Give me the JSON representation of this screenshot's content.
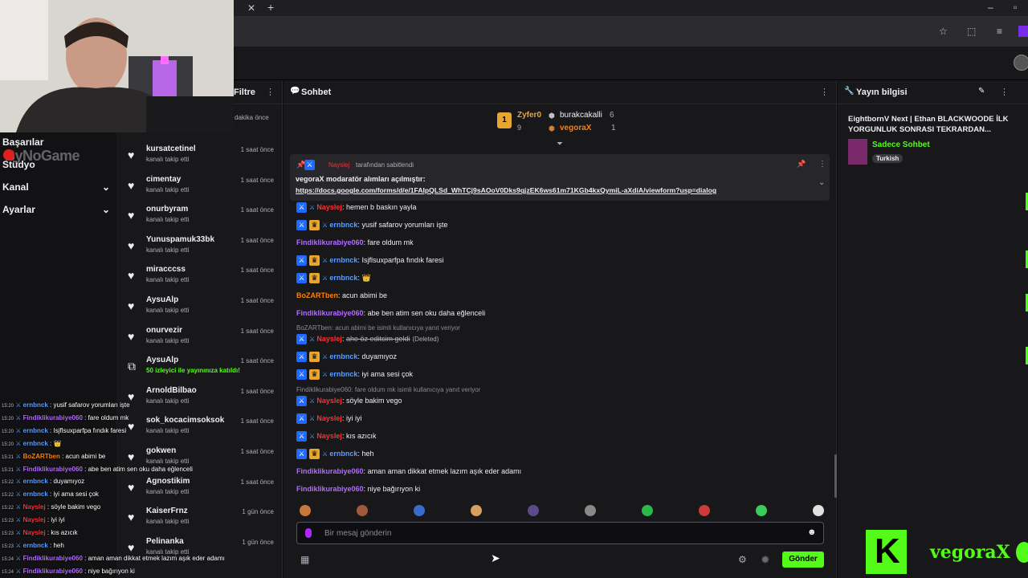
{
  "browser": {
    "icons": [
      "close-tab-icon",
      "new-tab-icon",
      "minimize-icon",
      "maximize-icon",
      "bookmark-star-icon",
      "extensions-icon",
      "media-icon",
      "profile-icon"
    ]
  },
  "left_nav": {
    "items": [
      {
        "label": "Başarılar",
        "chevron": false
      },
      {
        "label": "Stüdyo",
        "chevron": false
      },
      {
        "label": "Kanal",
        "chevron": true
      },
      {
        "label": "Ayarlar",
        "chevron": true
      }
    ],
    "watermark": "ByNoGame"
  },
  "activity": {
    "filter_label": "Filtre",
    "first_time": "dakika önce",
    "items": [
      {
        "name": "kursatcetinel",
        "sub": "kanalı takip etti",
        "time": "1 saat önce",
        "icon": "heart-icon"
      },
      {
        "name": "cimentay",
        "sub": "kanalı takip etti",
        "time": "1 saat önce",
        "icon": "heart-icon"
      },
      {
        "name": "onurbyram",
        "sub": "kanalı takip etti",
        "time": "1 saat önce",
        "icon": "heart-icon"
      },
      {
        "name": "Yunuspamuk33bk",
        "sub": "kanalı takip etti",
        "time": "1 saat önce",
        "icon": "heart-icon"
      },
      {
        "name": "miracccss",
        "sub": "kanalı takip etti",
        "time": "1 saat önce",
        "icon": "heart-icon"
      },
      {
        "name": "AysuAlp",
        "sub": "kanalı takip etti",
        "time": "1 saat önce",
        "icon": "heart-icon"
      },
      {
        "name": "onurvezir",
        "sub": "kanalı takip etti",
        "time": "1 saat önce",
        "icon": "heart-icon"
      },
      {
        "name": "AysuAlp",
        "sub": "50 izleyici ile yayınınıza katıldı!",
        "time": "1 saat önce",
        "icon": "raid-icon"
      },
      {
        "name": "ArnoldBilbao",
        "sub": "kanalı takip etti",
        "time": "1 saat önce",
        "icon": "heart-icon"
      },
      {
        "name": "sok_kocacimsoksok",
        "sub": "kanalı takip etti",
        "time": "1 saat önce",
        "icon": "heart-icon"
      },
      {
        "name": "gokwen",
        "sub": "kanalı takip etti",
        "time": "1 saat önce",
        "icon": "heart-icon"
      },
      {
        "name": "Agnostikim",
        "sub": "kanalı takip etti",
        "time": "1 saat önce",
        "icon": "heart-icon"
      },
      {
        "name": "KaiserFrnz",
        "sub": "kanalı takip etti",
        "time": "1 gün önce",
        "icon": "heart-icon"
      },
      {
        "name": "Pelinanka",
        "sub": "kanalı takip etti",
        "time": "1 gün önce",
        "icon": "heart-icon"
      }
    ]
  },
  "chat": {
    "title": "Sohbet",
    "leaderboard": [
      {
        "name": "Zyfer0",
        "count": "9",
        "rank": "1"
      },
      {
        "name": "burakcakalli",
        "count": "6"
      },
      {
        "name": "vegoraX",
        "count": "1"
      }
    ],
    "pinned": {
      "by": "Nayslej",
      "by_suffix": "tarafından sabitlendi",
      "text": "vegoraX modaratör alımları açılmıştır:",
      "link": "https://docs.google.com/forms/d/e/1FAIpQLSd_WhTCj9sAOoV0Dks9qjzEK6ws61m71KGb4kxQymiL-aXdiA/viewform?usp=dialog"
    },
    "messages": [
      {
        "user": "Nayslej",
        "cls": "u-nay",
        "badges": [
          "mod"
        ],
        "text": "hemen b baskın yayla"
      },
      {
        "user": "ernbnck",
        "cls": "u-ern",
        "badges": [
          "mod",
          "vip"
        ],
        "text": "yusif safarov yorumları işte"
      },
      {
        "user": "Findiklikurabiye060",
        "cls": "u-fin",
        "badges": [],
        "text": "fare oldum mk"
      },
      {
        "user": "ernbnck",
        "cls": "u-ern",
        "badges": [
          "mod",
          "vip"
        ],
        "text": "Isjflsuxparfpa fındık faresi"
      },
      {
        "user": "ernbnck",
        "cls": "u-ern",
        "badges": [
          "mod",
          "vip"
        ],
        "text": "👑"
      },
      {
        "user": "BoZARTben",
        "cls": "u-boz",
        "badges": [],
        "text": "acun abimi be"
      },
      {
        "user": "Findiklikurabiye060",
        "cls": "u-fin",
        "badges": [],
        "text": "abe ben atim sen oku daha eğlenceli"
      },
      {
        "reply": "BoZARTben: acun abimi be isimli kullanıcıya yanıt veriyor",
        "user": "Nayslej",
        "cls": "u-nay",
        "badges": [
          "mod"
        ],
        "text": "ahe öz editcim geldi",
        "deleted": "(Deleted)"
      },
      {
        "user": "ernbnck",
        "cls": "u-ern",
        "badges": [
          "mod",
          "vip"
        ],
        "text": "duyamıyoz"
      },
      {
        "user": "ernbnck",
        "cls": "u-ern",
        "badges": [
          "mod",
          "vip"
        ],
        "text": "iyi ama sesi çok"
      },
      {
        "reply": "Findiklikurabiye060: fare oldum mk isimli kullanıcıya yanıt veriyor",
        "user": "Nayslej",
        "cls": "u-nay",
        "badges": [
          "mod"
        ],
        "text": "söyle bakim vego"
      },
      {
        "user": "Nayslej",
        "cls": "u-nay",
        "badges": [
          "mod"
        ],
        "text": "iyi iyi"
      },
      {
        "user": "Nayslej",
        "cls": "u-nay",
        "badges": [
          "mod"
        ],
        "text": "kıs azıcık"
      },
      {
        "user": "ernbnck",
        "cls": "u-ern",
        "badges": [
          "mod",
          "vip"
        ],
        "text": "heh"
      },
      {
        "user": "Findiklikurabiye060",
        "cls": "u-fin",
        "badges": [],
        "text": "aman aman dikkat etmek lazım aşık eder adamı"
      },
      {
        "user": "Findiklikurabiye060",
        "cls": "u-fin",
        "badges": [],
        "text": "niye bağırıyon ki"
      }
    ],
    "input_placeholder": "Bir mesaj gönderin",
    "send_label": "Gönder",
    "emote_colors": [
      "#c8783c",
      "#a05a3a",
      "#3a6acc",
      "#d4a060",
      "#5a4a8a",
      "#888888",
      "#2ab84a",
      "#cc3a3a",
      "#3acc5a",
      "#e0e0e0"
    ]
  },
  "info": {
    "title": "Yayın bilgisi",
    "stream_title": "EightbornV Next | Ethan BLACKWOODE İLK YORGUNLUK SONRASI TEKRARDAN...",
    "category": "Sadece Sohbet",
    "tag": "Turkish",
    "brand": "vegoraX",
    "accent": "#53fc18"
  },
  "overlay": [
    {
      "time": "15:20",
      "user": "ernbnck",
      "cls": "u-ern",
      "text": "yusif safarov yorumları işte"
    },
    {
      "time": "15:20",
      "user": "Findiklikurabiye060",
      "cls": "u-fin",
      "text": "fare oldum mk"
    },
    {
      "time": "15:20",
      "user": "ernbnck",
      "cls": "u-ern",
      "text": "Isjflsuxparfpa fındık faresi"
    },
    {
      "time": "15:20",
      "user": "ernbnck",
      "cls": "u-ern",
      "text": "👑"
    },
    {
      "time": "15:21",
      "user": "BoZARTben",
      "cls": "u-boz",
      "text": "acun abimi be"
    },
    {
      "time": "15:21",
      "user": "Findiklikurabiye060",
      "cls": "u-fin",
      "text": "abe ben atim sen oku daha eğlenceli"
    },
    {
      "time": "15:22",
      "user": "ernbnck",
      "cls": "u-ern",
      "text": "duyamıyoz"
    },
    {
      "time": "15:22",
      "user": "ernbnck",
      "cls": "u-ern",
      "text": "iyi ama sesi çok"
    },
    {
      "time": "15:22",
      "user": "Nayslej",
      "cls": "u-nay",
      "text": "söyle bakim vego"
    },
    {
      "time": "15:23",
      "user": "Nayslej",
      "cls": "u-nay",
      "text": "iyi iyi"
    },
    {
      "time": "15:23",
      "user": "Nayslej",
      "cls": "u-nay",
      "text": "kıs azıcık"
    },
    {
      "time": "15:23",
      "user": "ernbnck",
      "cls": "u-ern",
      "text": "heh"
    },
    {
      "time": "15:24",
      "user": "Findiklikurabiye060",
      "cls": "u-fin",
      "text": "aman aman dikkat etmek lazım aşık eder adamı"
    },
    {
      "time": "15:24",
      "user": "Findiklikurabiye060",
      "cls": "u-fin",
      "text": "niye bağırıyon ki"
    }
  ]
}
